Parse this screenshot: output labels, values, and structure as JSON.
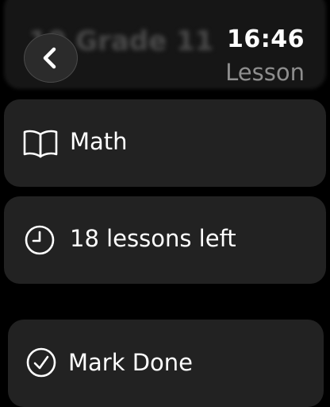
{
  "background_list": {
    "faded_item_text": "10 Grade 11"
  },
  "header": {
    "back_icon": "chevron-left-icon",
    "time": "16:46",
    "title": "Lesson"
  },
  "rows": {
    "subject": {
      "icon": "book-icon",
      "label": "Math"
    },
    "lessons_left": {
      "icon": "clock-icon",
      "label": "18 lessons left"
    }
  },
  "actions": {
    "mark_done": {
      "icon": "checkmark-circle-icon",
      "label": "Mark Done"
    }
  },
  "colors": {
    "background": "#000000",
    "card": "#222222",
    "text_primary": "#ffffff",
    "text_secondary": "#8e8e8e"
  }
}
